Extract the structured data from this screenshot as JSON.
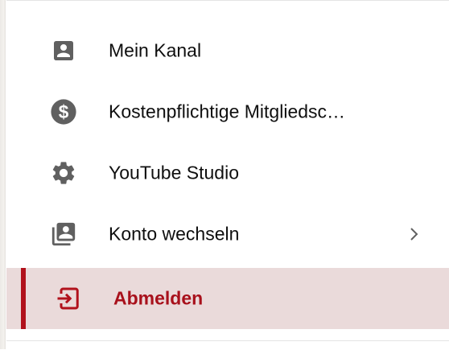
{
  "menu": {
    "items": [
      {
        "label": "Mein Kanal",
        "icon": "account-box-icon"
      },
      {
        "label": "Kostenpflichtige Mitgliedsc…",
        "icon": "dollar-circle-icon"
      },
      {
        "label": "YouTube Studio",
        "icon": "gear-icon"
      },
      {
        "label": "Konto wechseln",
        "icon": "switch-account-icon",
        "has_submenu": true
      },
      {
        "label": "Abmelden",
        "icon": "sign-out-icon",
        "active": true
      }
    ]
  },
  "colors": {
    "icon_gray": "#606060",
    "active_background": "#eadada",
    "active_accent": "#b1111c",
    "active_text": "#a8101b"
  }
}
